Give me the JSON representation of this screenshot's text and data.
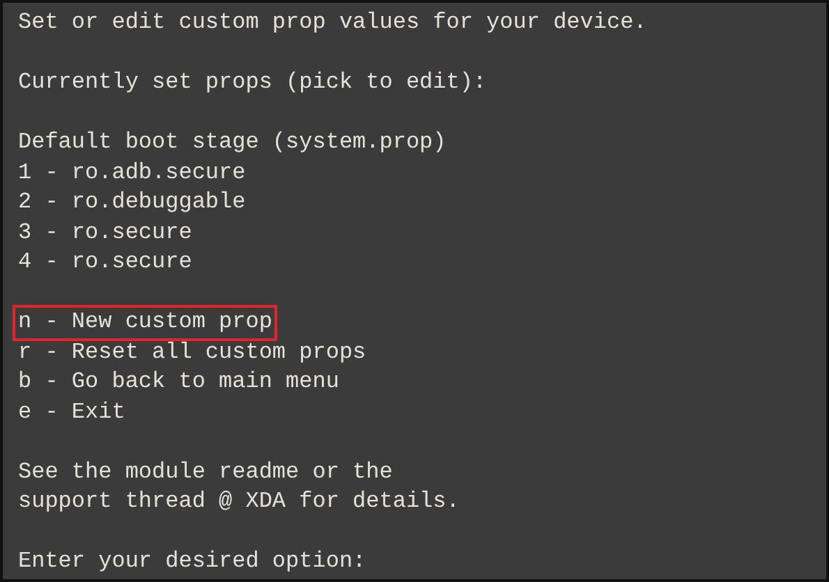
{
  "terminal": {
    "lines": [
      {
        "kind": "text",
        "text": "Set or edit custom prop values for your device."
      },
      {
        "kind": "blank"
      },
      {
        "kind": "text",
        "text": "Currently set props (pick to edit):"
      },
      {
        "kind": "blank"
      },
      {
        "kind": "text",
        "text": "Default boot stage (system.prop)"
      },
      {
        "kind": "option",
        "text": "1 - ro.adb.secure",
        "selected": false
      },
      {
        "kind": "option",
        "text": "2 - ro.debuggable",
        "selected": false
      },
      {
        "kind": "option",
        "text": "3 - ro.secure",
        "selected": false
      },
      {
        "kind": "option",
        "text": "4 - ro.secure",
        "selected": false
      },
      {
        "kind": "blank"
      },
      {
        "kind": "option",
        "text": "n - New custom prop",
        "selected": true
      },
      {
        "kind": "option",
        "text": "r - Reset all custom props",
        "selected": false
      },
      {
        "kind": "option",
        "text": "b - Go back to main menu",
        "selected": false
      },
      {
        "kind": "option",
        "text": "e - Exit",
        "selected": false
      },
      {
        "kind": "blank"
      },
      {
        "kind": "text",
        "text": "See the module readme or the"
      },
      {
        "kind": "text",
        "text": "support thread @ XDA for details."
      },
      {
        "kind": "blank"
      },
      {
        "kind": "text",
        "text": "Enter your desired option:"
      }
    ]
  }
}
